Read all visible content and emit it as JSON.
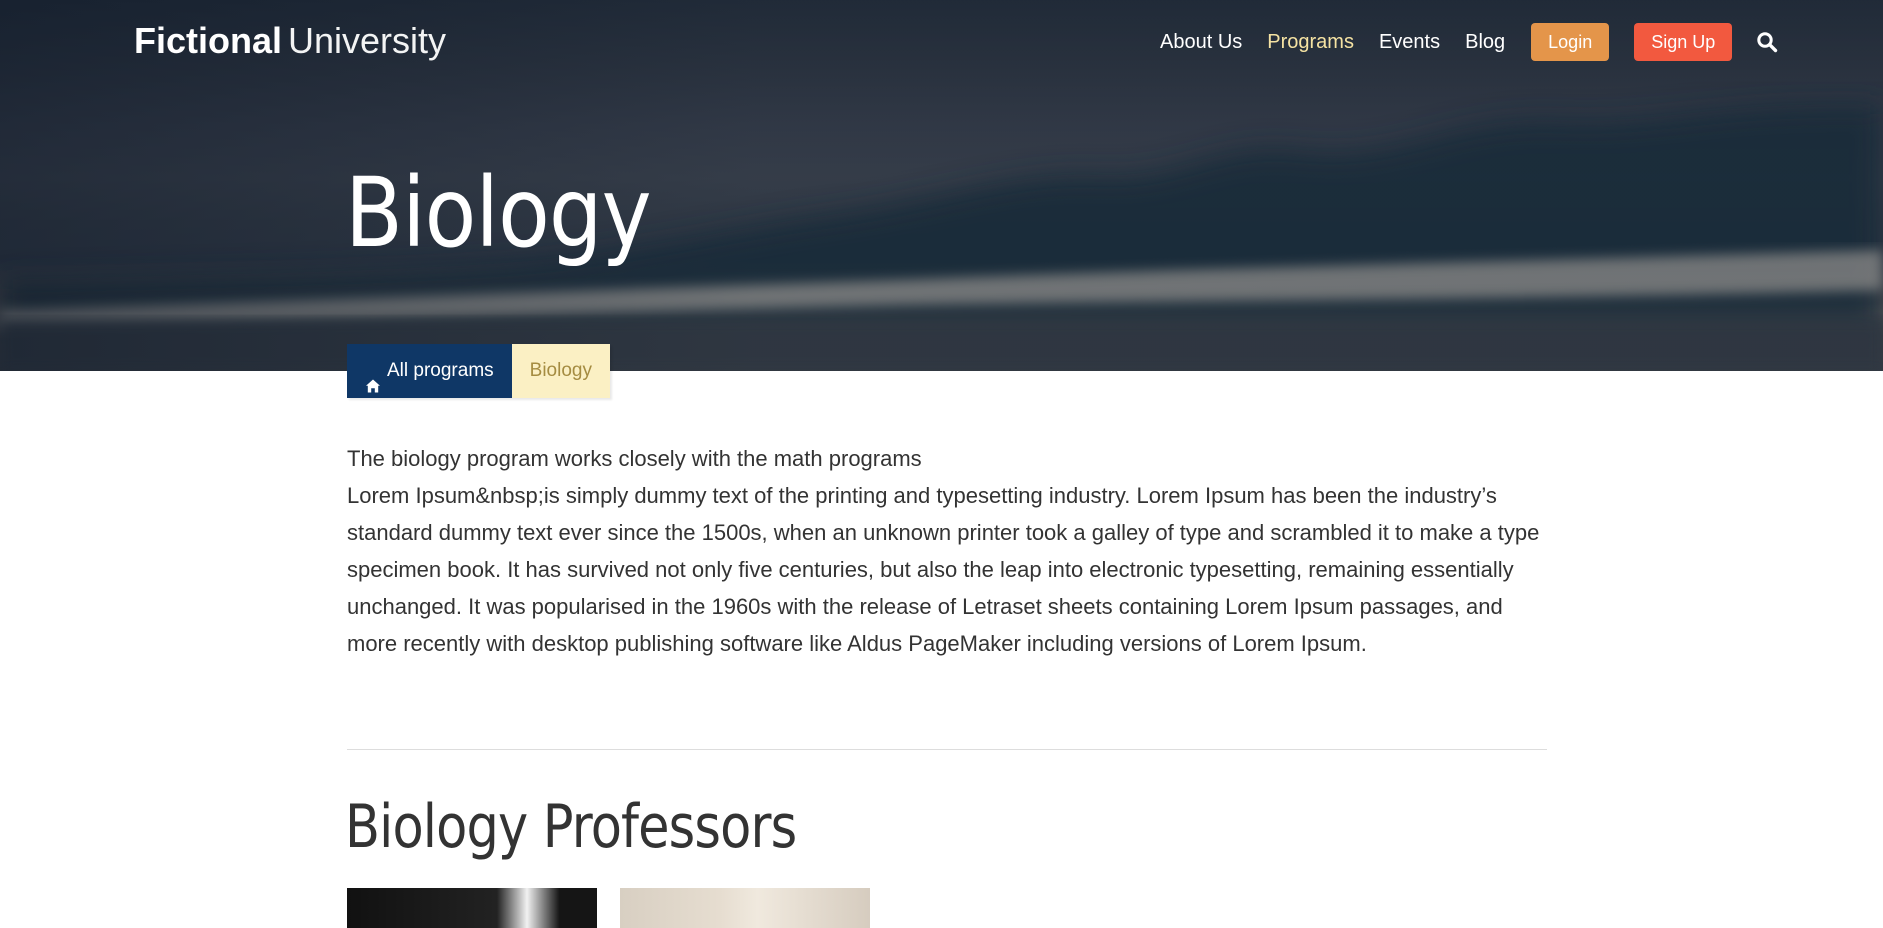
{
  "header": {
    "logo_bold": "Fictional",
    "logo_light": "University",
    "nav": [
      {
        "label": "About Us",
        "active": false
      },
      {
        "label": "Programs",
        "active": true
      },
      {
        "label": "Events",
        "active": false
      },
      {
        "label": "Blog",
        "active": false
      }
    ],
    "login_label": "Login",
    "signup_label": "Sign Up",
    "search_icon": "search-icon"
  },
  "hero": {
    "title": "Biology"
  },
  "breadcrumb": {
    "parent_icon": "home-icon",
    "parent_label": "All programs",
    "current_label": "Biology"
  },
  "content": {
    "intro": "The biology program works closely with the math programs",
    "body": "Lorem Ipsum&nbsp;is simply dummy text of the printing and typesetting industry. Lorem Ipsum has been the industry’s standard dummy text ever since the 1500s, when an unknown printer took a galley of type and scrambled it to make a type specimen book. It has survived not only five centuries, but also the leap into electronic typesetting, remaining essentially unchanged. It was popularised in the 1960s with the release of Letraset sheets containing Lorem Ipsum passages, and more recently with desktop publishing software like Aldus PageMaker including versions of Lorem Ipsum."
  },
  "professors": {
    "title": "Biology Professors"
  },
  "colors": {
    "nav_active": "#f5e3a3",
    "login_button": "#e4954a",
    "signup_button": "#f2593f",
    "breadcrumb_parent": "#0f3766",
    "breadcrumb_current_bg": "#fbf0c4",
    "breadcrumb_current_text": "#a58c41"
  }
}
